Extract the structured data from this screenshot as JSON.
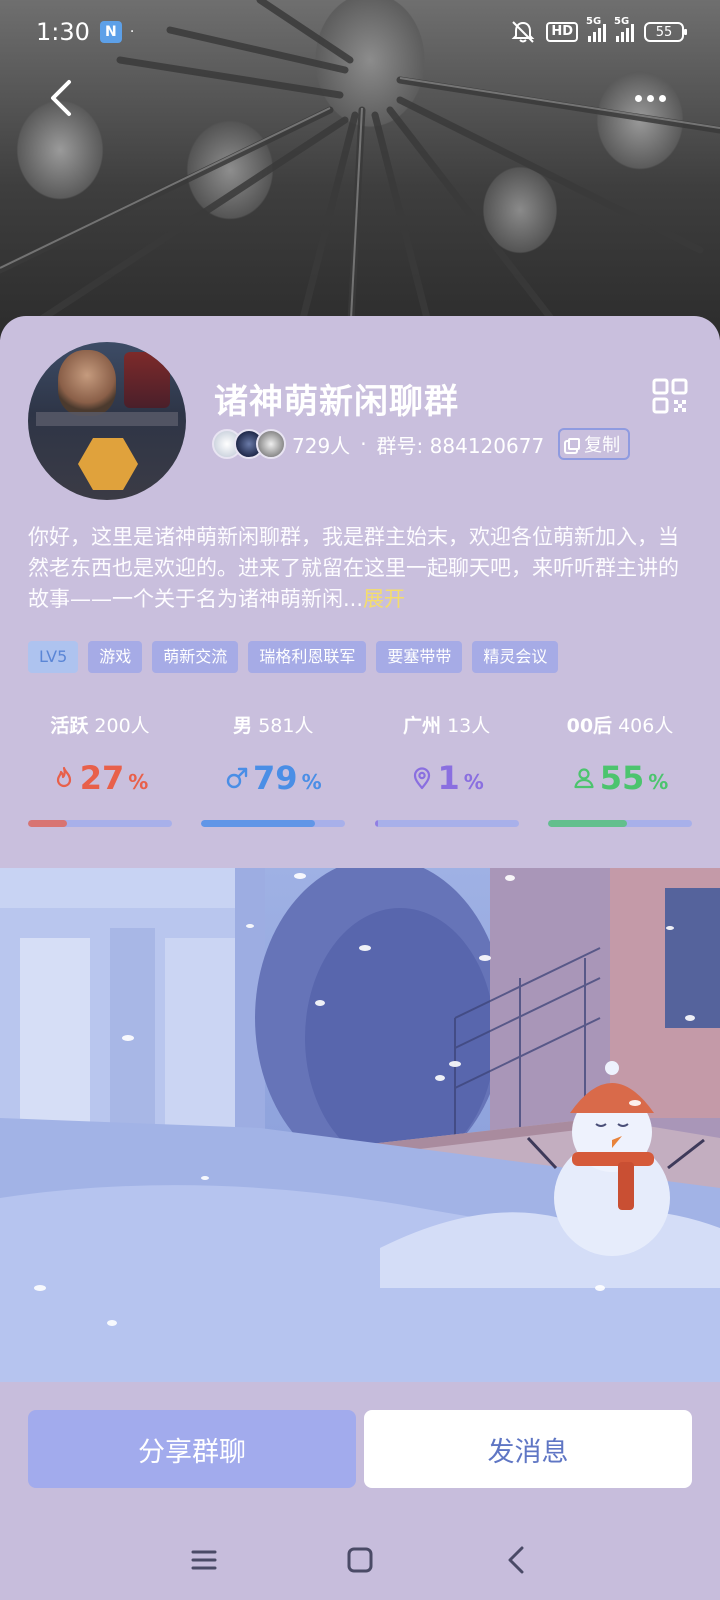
{
  "status_bar": {
    "time": "1:30",
    "nfc_label": "N",
    "dot": "·",
    "hd_label": "HD",
    "signal_1_label": "5G",
    "signal_2_label": "5G",
    "battery": "55"
  },
  "group": {
    "name": "诸神萌新闲聊群",
    "member_count": "729人",
    "separator": "·",
    "group_number": "群号: 884120677",
    "copy_label": "复制"
  },
  "intro": {
    "text": "你好，这里是诸神萌新闲聊群，我是群主始末，欢迎各位萌新加入，当然老东西也是欢迎的。进来了就留在这里一起聊天吧，来听听群主讲的故事——一个关于名为诸神萌新闲...",
    "expand_label": "展开"
  },
  "tags": [
    "LV5",
    "游戏",
    "萌新交流",
    "瑞格利恩联军",
    "要塞带带",
    "精灵会议"
  ],
  "stats": [
    {
      "label": "活跃",
      "count": "200人",
      "percent": "27",
      "unit": "%",
      "color": "#e8604a",
      "icon": "flame-icon",
      "fill": 0.27
    },
    {
      "label": "男",
      "count": "581人",
      "percent": "79",
      "unit": "%",
      "color": "#4a8ee6",
      "icon": "male-icon",
      "fill": 0.79
    },
    {
      "label": "广州",
      "count": "13人",
      "percent": "1",
      "unit": "%",
      "color": "#8a6fe0",
      "icon": "location-pin-icon",
      "fill": 0.01
    },
    {
      "label": "00后",
      "count": "406人",
      "percent": "55",
      "unit": "%",
      "color": "#4cc46e",
      "icon": "person-icon",
      "fill": 0.55
    }
  ],
  "actions": {
    "share_label": "分享群聊",
    "message_label": "发消息"
  },
  "colors": {
    "card_bg": "#c9bfdd",
    "tag_bg": "#a6abe6",
    "expand": "#f4dd6c",
    "share_btn": "#a2abed",
    "message_text": "#5f76c4"
  }
}
